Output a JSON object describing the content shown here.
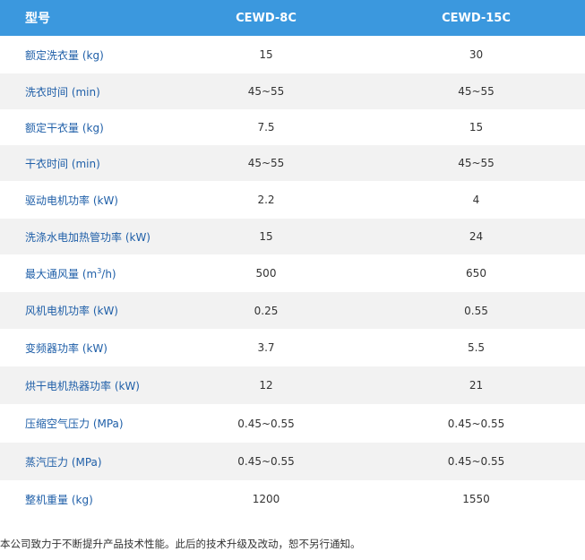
{
  "table": {
    "headers": [
      "型号",
      "CEWD-8C",
      "CEWD-15C"
    ],
    "rows": [
      {
        "label": "额定洗衣量 (kg)",
        "c8": "15",
        "c15": "30"
      },
      {
        "label": "洗衣时间 (min)",
        "c8": "45~55",
        "c15": "45~55"
      },
      {
        "label": "额定干衣量 (kg)",
        "c8": "7.5",
        "c15": "15"
      },
      {
        "label": "干衣时间 (min)",
        "c8": "45~55",
        "c15": "45~55"
      },
      {
        "label": "驱动电机功率 (kW)",
        "c8": "2.2",
        "c15": "4"
      },
      {
        "label": "洗涤水电加热管功率 (kW)",
        "c8": "15",
        "c15": "24"
      },
      {
        "label_prefix": "最大通风量 (m",
        "label_sup": "3",
        "label_suffix": "/h)",
        "c8": "500",
        "c15": "650"
      },
      {
        "label": "风机电机功率 (kW)",
        "c8": "0.25",
        "c15": "0.55"
      },
      {
        "label": "变频器功率 (kW)",
        "c8": "3.7",
        "c15": "5.5"
      },
      {
        "label": "烘干电机热器功率 (kW)",
        "c8": "12",
        "c15": "21"
      },
      {
        "label": "压缩空气压力 (MPa)",
        "c8": "0.45~0.55",
        "c15": "0.45~0.55"
      },
      {
        "label": "蒸汽压力 (MPa)",
        "c8": "0.45~0.55",
        "c15": "0.45~0.55"
      },
      {
        "label": "整机重量 (kg)",
        "c8": "1200",
        "c15": "1550"
      }
    ]
  },
  "footnote": "本公司致力于不断提升产品技术性能。此后的技术升级及改动，恕不另行通知。",
  "colors": {
    "header_bg": "#3b98de",
    "label_text": "#1f5fa8",
    "stripe": "#f2f2f2"
  }
}
